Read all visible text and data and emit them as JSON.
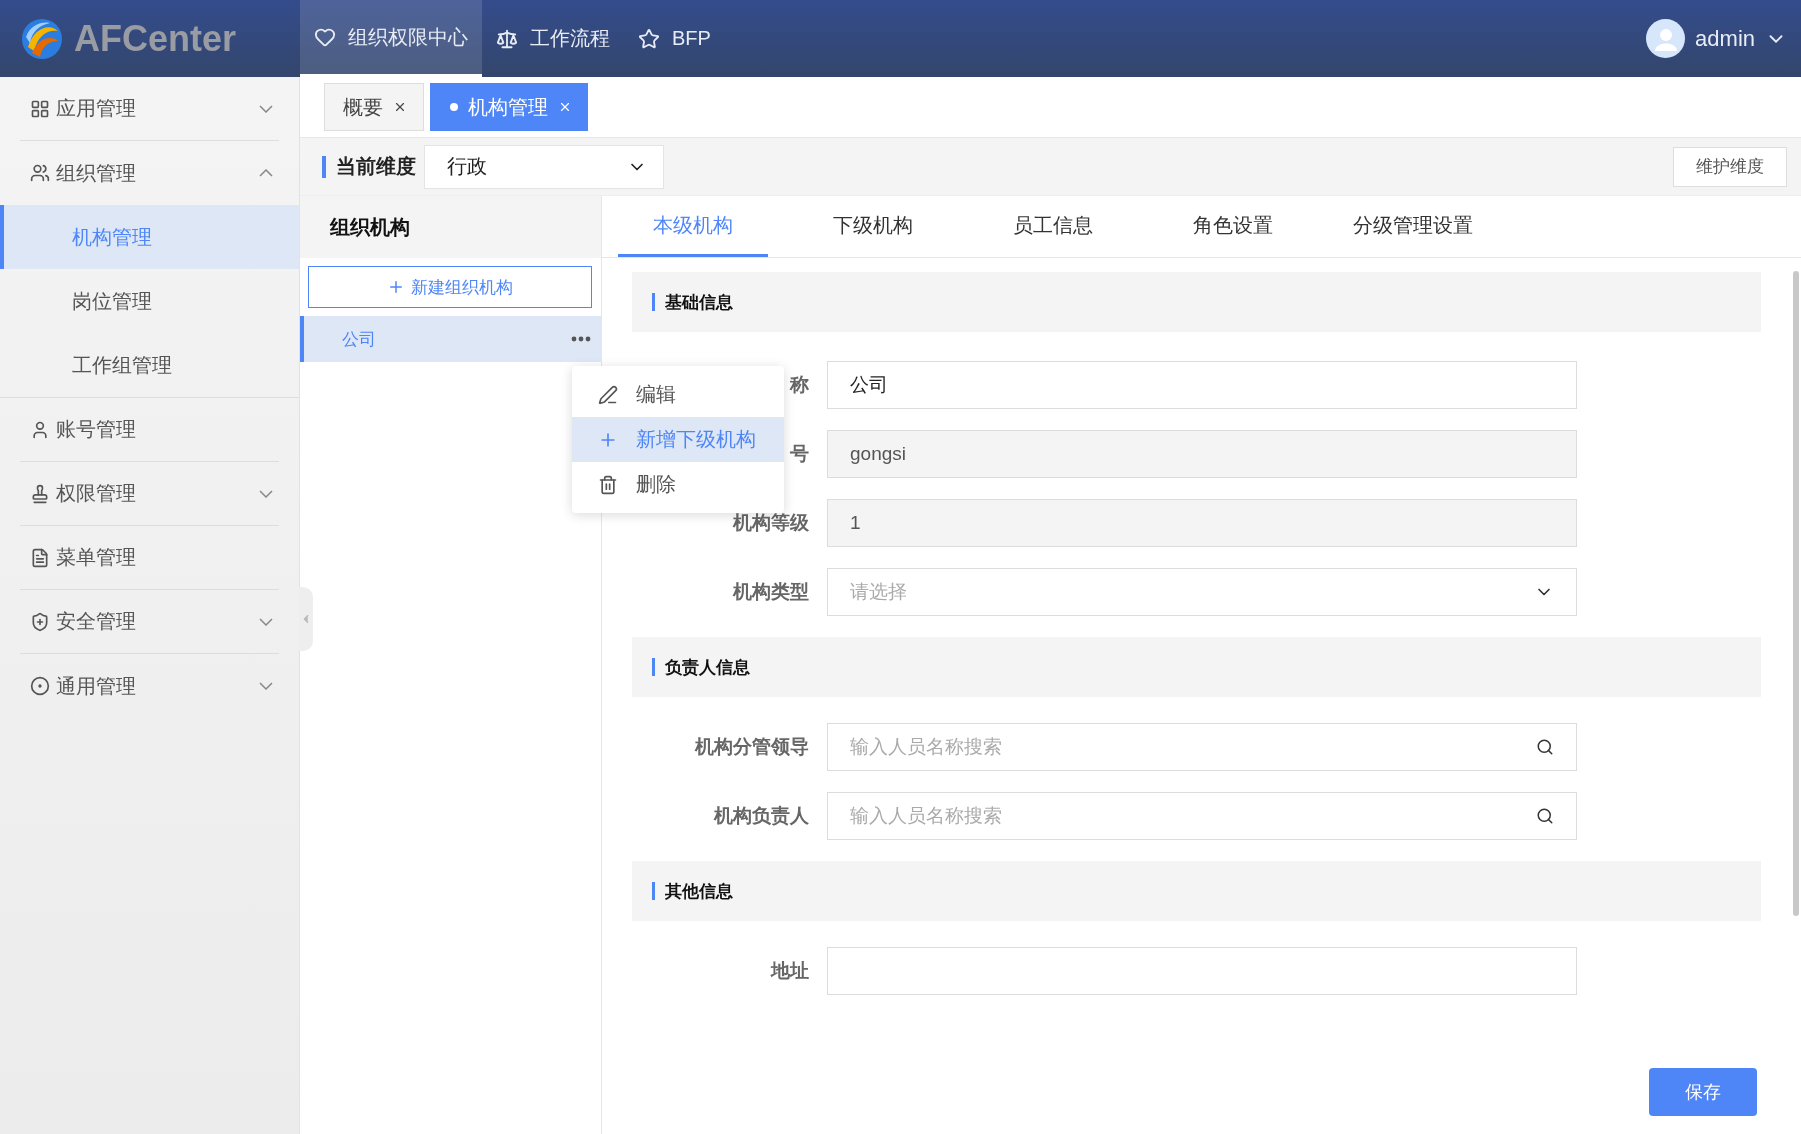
{
  "header": {
    "logo": "AFCenter",
    "nav": [
      {
        "label": "组织权限中心",
        "selected": true
      },
      {
        "label": "工作流程",
        "selected": false
      },
      {
        "label": "BFP",
        "selected": false
      }
    ],
    "user": "admin"
  },
  "sidebar": {
    "items": [
      {
        "label": "应用管理",
        "expanded": false
      },
      {
        "label": "组织管理",
        "expanded": true,
        "children": [
          {
            "label": "机构管理",
            "selected": true
          },
          {
            "label": "岗位管理",
            "selected": false
          },
          {
            "label": "工作组管理",
            "selected": false
          }
        ]
      },
      {
        "label": "账号管理"
      },
      {
        "label": "权限管理",
        "expanded": false
      },
      {
        "label": "菜单管理"
      },
      {
        "label": "安全管理",
        "expanded": false
      },
      {
        "label": "通用管理",
        "expanded": false
      }
    ]
  },
  "page_tabs": [
    {
      "label": "概要",
      "selected": false
    },
    {
      "label": "机构管理",
      "selected": true
    }
  ],
  "dimension": {
    "label": "当前维度",
    "value": "行政",
    "button": "维护维度"
  },
  "org_tree": {
    "title": "组织机构",
    "new_button": "新建组织机构",
    "nodes": [
      {
        "label": "公司",
        "selected": true
      }
    ],
    "context_menu": [
      {
        "label": "编辑",
        "selected": false
      },
      {
        "label": "新增下级机构",
        "selected": true
      },
      {
        "label": "删除",
        "selected": false
      }
    ]
  },
  "detail_tabs": [
    {
      "label": "本级机构",
      "selected": true
    },
    {
      "label": "下级机构",
      "selected": false
    },
    {
      "label": "员工信息",
      "selected": false
    },
    {
      "label": "角色设置",
      "selected": false
    },
    {
      "label": "分级管理设置",
      "selected": false
    }
  ],
  "sections": [
    {
      "title": "基础信息",
      "fields": [
        {
          "label": "称",
          "kind": "text",
          "value": "公司"
        },
        {
          "label": "号",
          "kind": "readonly",
          "value": "gongsi"
        },
        {
          "label": "机构等级",
          "kind": "readonly",
          "value": "1"
        },
        {
          "label": "机构类型",
          "kind": "select",
          "placeholder": "请选择"
        }
      ]
    },
    {
      "title": "负责人信息",
      "fields": [
        {
          "label": "机构分管领导",
          "kind": "search",
          "placeholder": "输入人员名称搜索"
        },
        {
          "label": "机构负责人",
          "kind": "search",
          "placeholder": "输入人员名称搜索"
        }
      ]
    },
    {
      "title": "其他信息",
      "fields": [
        {
          "label": "地址",
          "kind": "text"
        }
      ]
    }
  ],
  "save_button": "保存"
}
